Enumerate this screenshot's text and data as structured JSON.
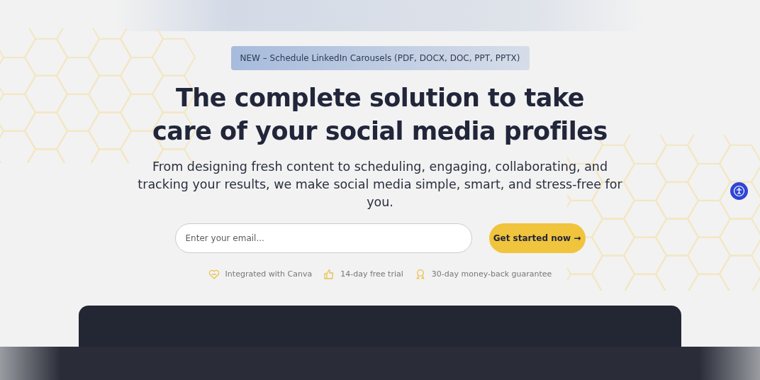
{
  "announcement": "NEW – Schedule LinkedIn Carousels (PDF, DOCX, DOC, PPT, PPTX)",
  "headline": [
    "The complete solution to take",
    "care of your social media profiles"
  ],
  "subtitle": "From designing fresh content to scheduling, engaging, collaborating, and tracking your results, we make social media simple, smart, and stress-free for you.",
  "signup": {
    "placeholder": "Enter your email...",
    "button": "Get started now →"
  },
  "features": [
    {
      "kind": "heart",
      "label": "Integrated with Canva"
    },
    {
      "kind": "thumb",
      "label": "14-day free trial"
    },
    {
      "kind": "award",
      "label": "30-day money-back guarantee"
    }
  ]
}
